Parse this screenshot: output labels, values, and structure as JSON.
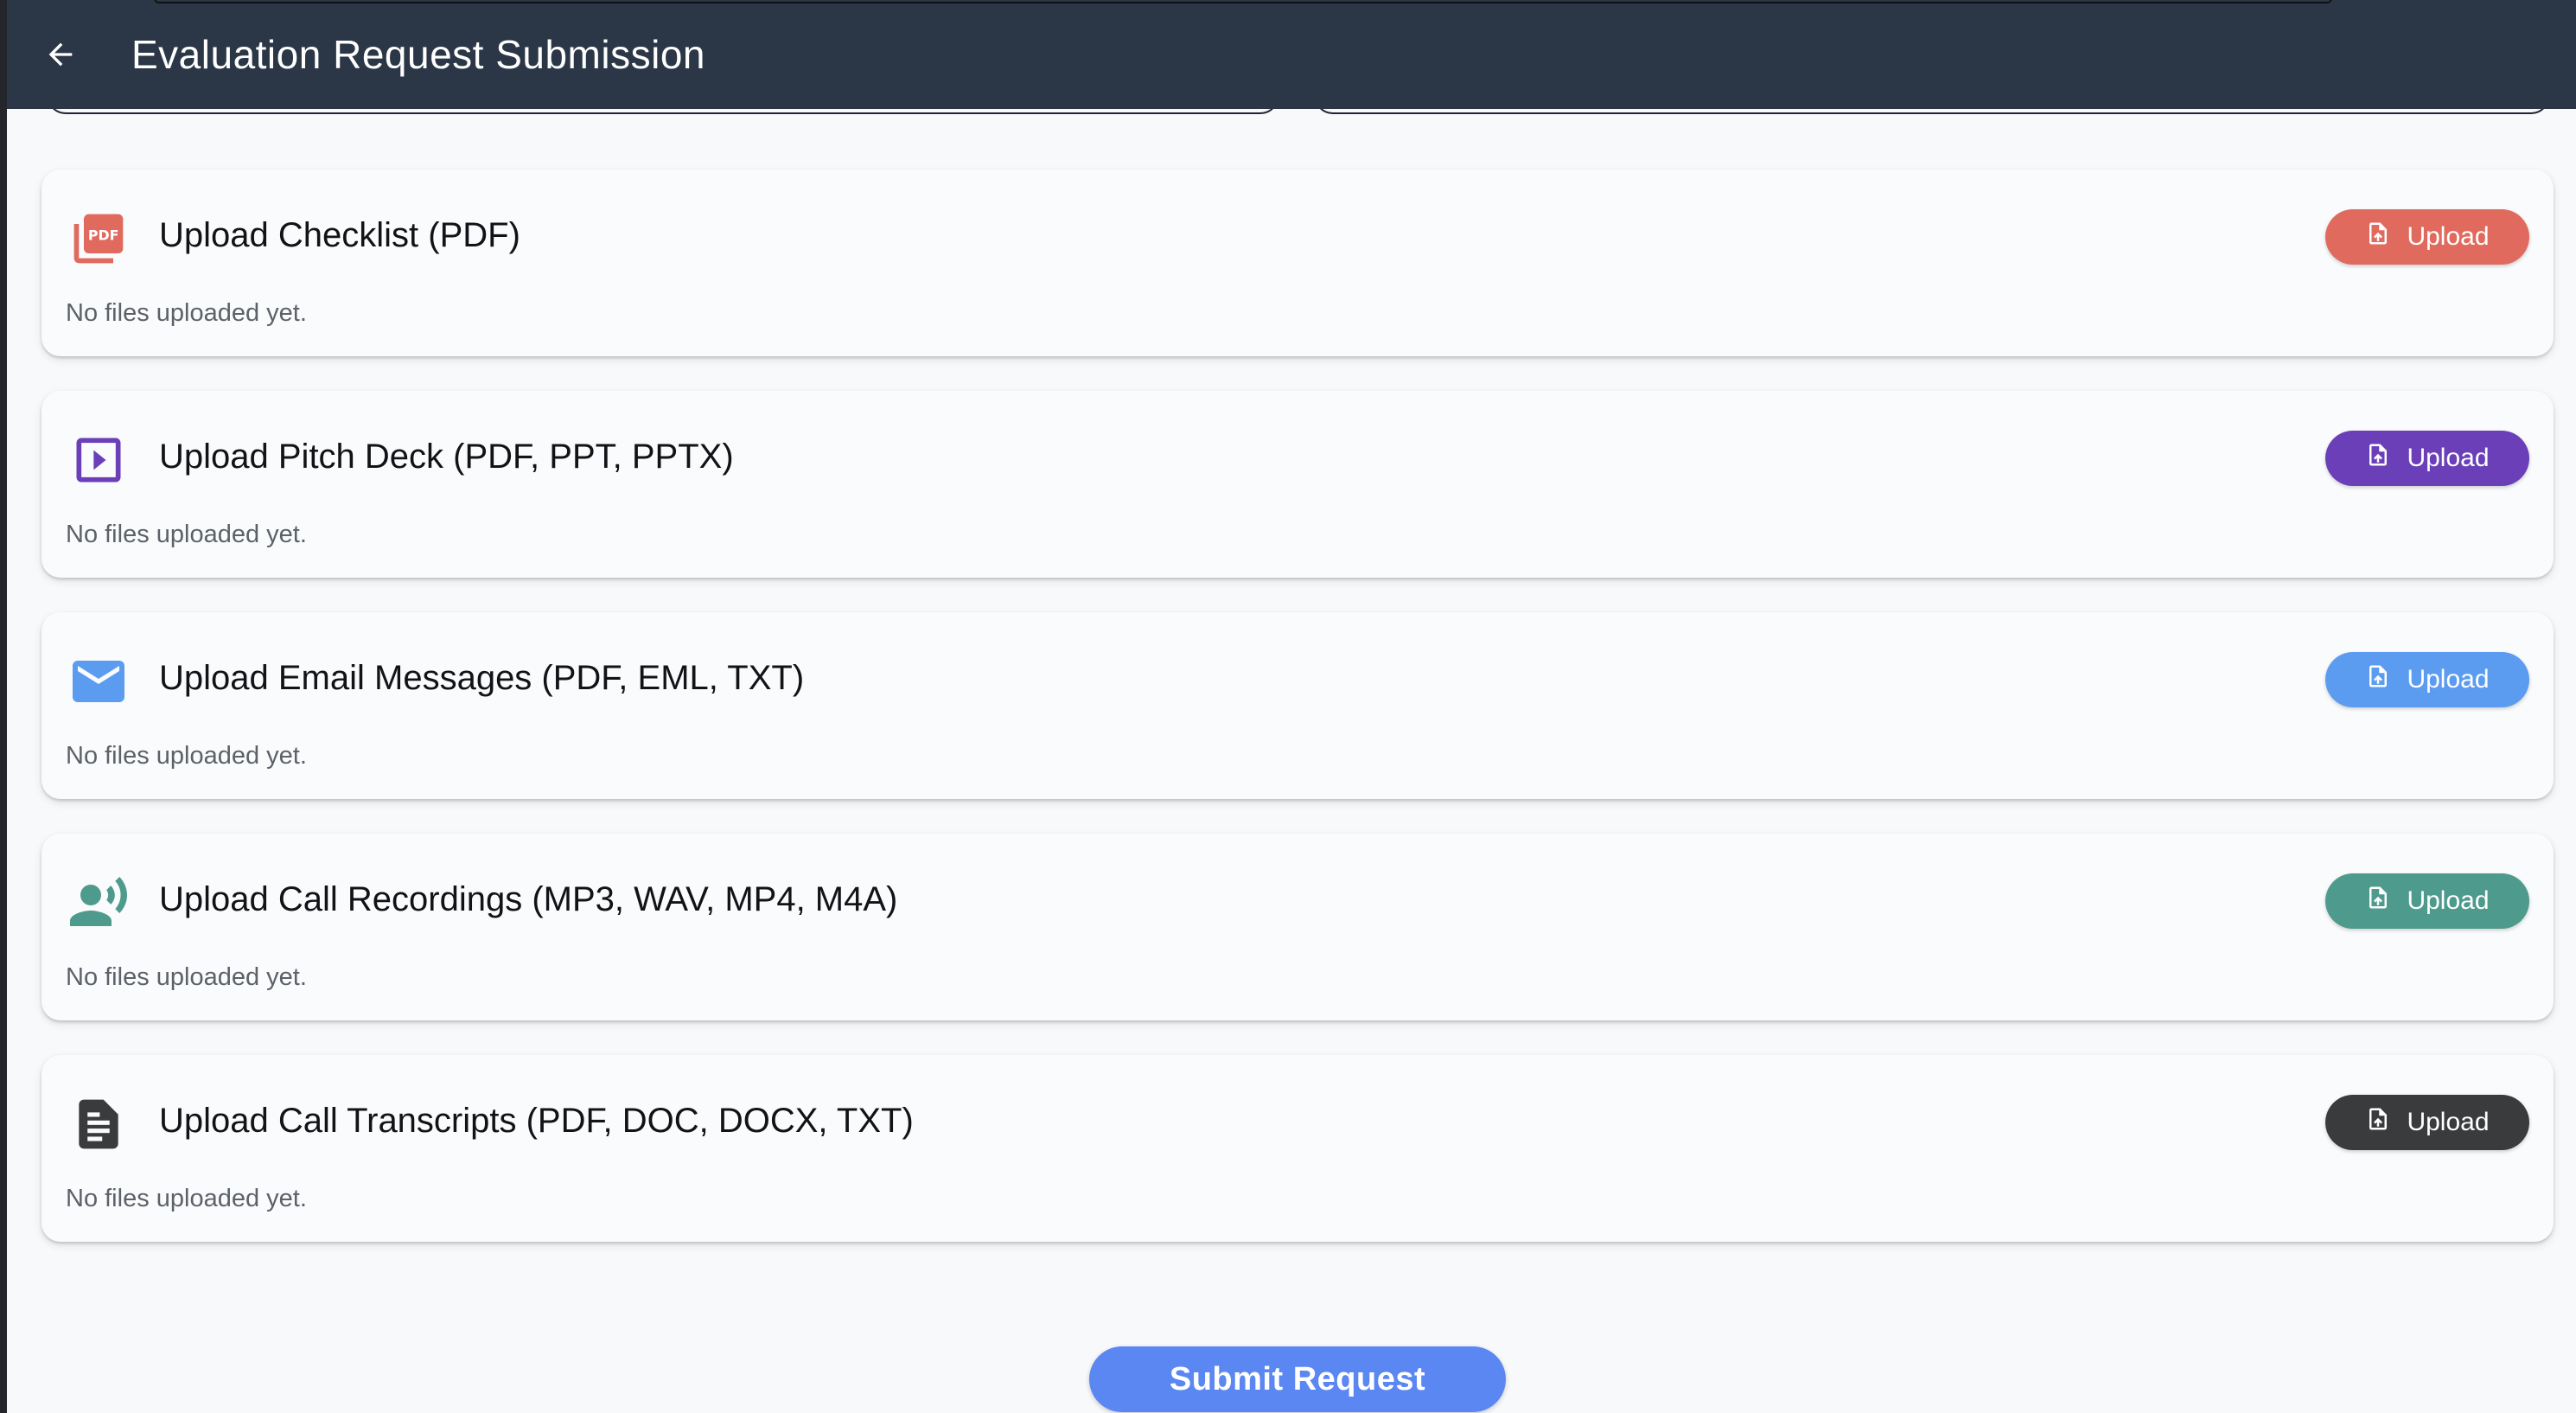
{
  "header": {
    "title": "Evaluation Request Submission",
    "back_icon": "arrow-left-icon"
  },
  "sections": [
    {
      "title": "Upload Checklist (PDF)",
      "status": "No files uploaded yet.",
      "button_label": "Upload",
      "icon": "pdf-icon",
      "icon_text": "PDF",
      "color": "#e06a5d"
    },
    {
      "title": "Upload Pitch Deck (PDF, PPT, PPTX)",
      "status": "No files uploaded yet.",
      "button_label": "Upload",
      "icon": "slideshow-icon",
      "color": "#6a3fb8"
    },
    {
      "title": "Upload Email Messages (PDF, EML, TXT)",
      "status": "No files uploaded yet.",
      "button_label": "Upload",
      "icon": "email-icon",
      "color": "#5c9cf0"
    },
    {
      "title": "Upload Call Recordings (MP3, WAV, MP4, M4A)",
      "status": "No files uploaded yet.",
      "button_label": "Upload",
      "icon": "record-voice-icon",
      "color": "#4e9a8c"
    },
    {
      "title": "Upload Call Transcripts (PDF, DOC, DOCX, TXT)",
      "status": "No files uploaded yet.",
      "button_label": "Upload",
      "icon": "document-icon",
      "color": "#3a3b3d"
    }
  ],
  "submit": {
    "label": "Submit Request",
    "color": "#5b87f2"
  }
}
